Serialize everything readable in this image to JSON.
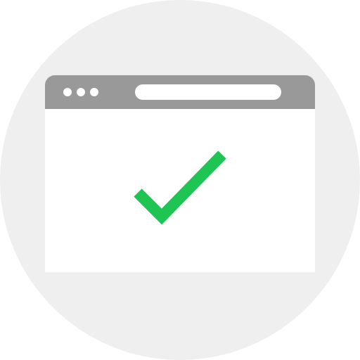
{
  "colors": {
    "background_circle": "#efefef",
    "title_bar": "#999999",
    "window": "#ffffff",
    "checkmark": "#1ec552"
  },
  "icons": {
    "background": "circle-background-icon",
    "window": "browser-window-icon",
    "check": "checkmark-icon"
  }
}
